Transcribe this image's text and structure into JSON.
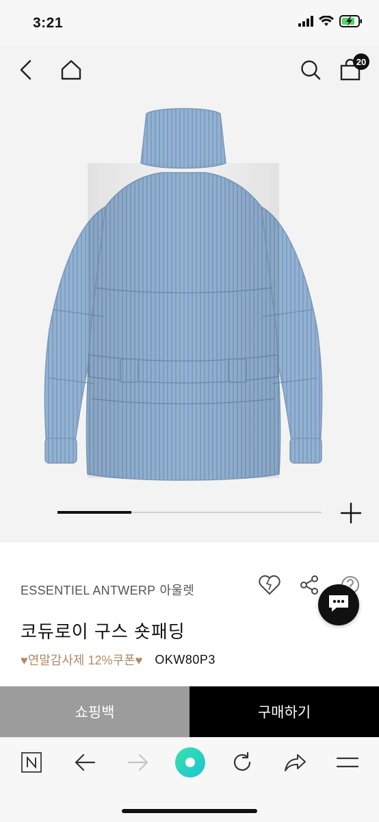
{
  "status_bar": {
    "time": "3:21",
    "icons": [
      "signal-icon",
      "wifi-icon",
      "battery-charging-icon"
    ]
  },
  "header": {
    "back_icon": "chevron-left-icon",
    "home_icon": "home-icon",
    "search_icon": "search-icon",
    "cart_icon": "shopping-bag-icon",
    "cart_count": "20"
  },
  "gallery": {
    "image": "light blue corduroy puffer jacket with belt",
    "progress_fraction": 0.28,
    "expand_icon": "plus-icon"
  },
  "product": {
    "brand": "ESSENTIEL ANTWERP",
    "store_type": "아울렛",
    "title": "코듀로이 구스 숏패딩",
    "promo": "♥연말감사제 12%쿠폰♥",
    "code": "OKW80P3",
    "wishlist_icon": "heart-icon",
    "share_icon": "share-icon",
    "help_icon": "question-icon"
  },
  "chat": {
    "icon": "chat-bubble-icon"
  },
  "actions": {
    "shopping_bag_label": "쇼핑백",
    "buy_label": "구매하기"
  },
  "browser_toolbar": {
    "items": [
      "n-logo-icon",
      "back-arrow-icon",
      "forward-arrow-icon",
      "green-dot-icon",
      "refresh-icon",
      "share-arrow-icon",
      "menu-icon"
    ]
  },
  "colors": {
    "promo": "#b08a66",
    "buy_button": "#000000",
    "bag_button": "#9c9c9c",
    "jacket": "#93b2d2",
    "accent_green": "#2fd79a"
  }
}
